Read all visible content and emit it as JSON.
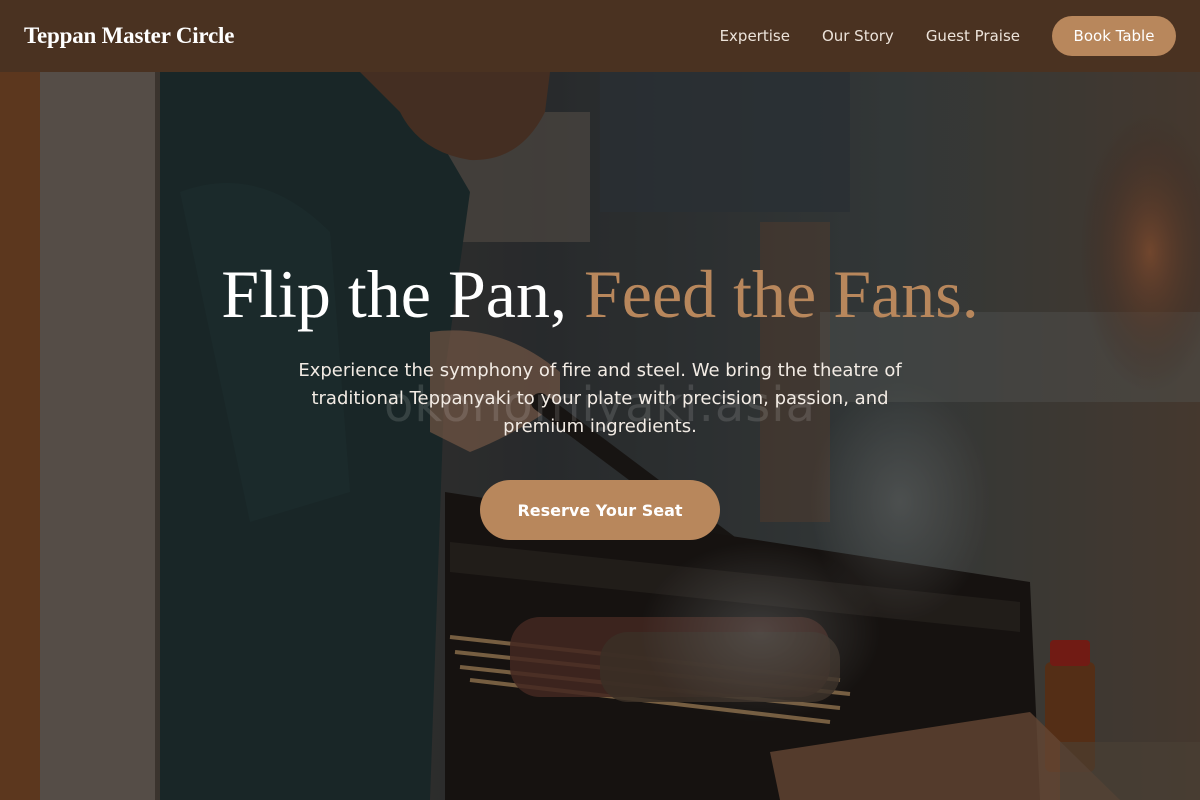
{
  "header": {
    "brand": "Teppan Master Circle",
    "nav": [
      {
        "label": "Expertise"
      },
      {
        "label": "Our Story"
      },
      {
        "label": "Guest Praise"
      }
    ],
    "cta_label": "Book Table"
  },
  "hero": {
    "headline_main": "Flip the Pan, ",
    "headline_accent": "Feed the Fans.",
    "subtext": "Experience the symphony of fire and steel. We bring the theatre of traditional Teppanyaki to your plate with precision, passion, and premium ingredients.",
    "watermark": "okonomiyaki.asia",
    "button_label": "Reserve Your Seat"
  },
  "colors": {
    "header_bg": "#4a3221",
    "accent": "#b8875c",
    "text_light": "#ffffff"
  }
}
